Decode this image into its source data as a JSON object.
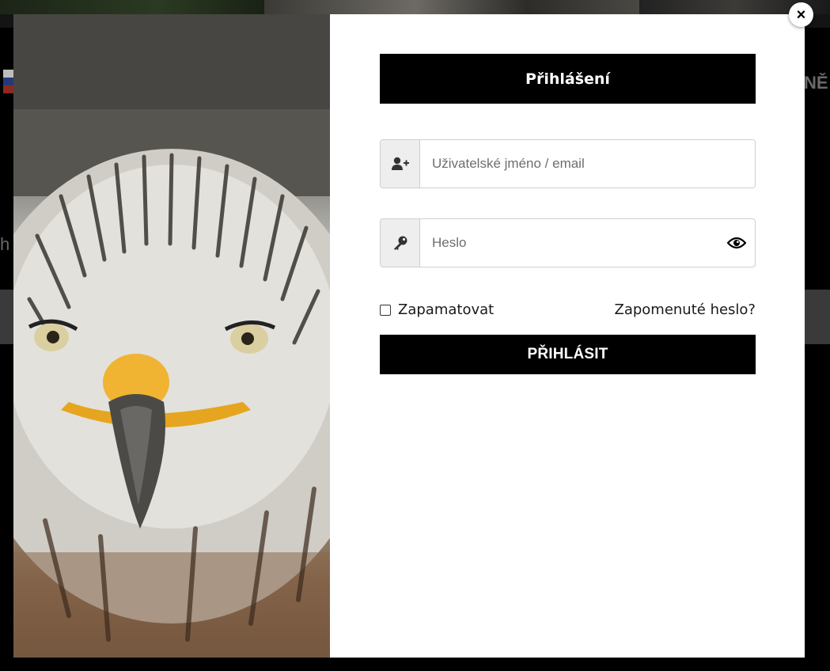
{
  "background": {
    "nav_fragment": "NĚ",
    "side_fragment": "h",
    "flag_colors": [
      "#ffffff",
      "#1c3f95",
      "#d52b1e"
    ]
  },
  "modal": {
    "close_symbol": "×",
    "image_alt": "eagle-portrait",
    "title": "Přihlášení",
    "username": {
      "placeholder": "Uživatelské jméno / email",
      "icon": "user-plus-icon"
    },
    "password": {
      "placeholder": "Heslo",
      "icon": "key-icon",
      "toggle_icon": "eye-icon"
    },
    "remember_label": "Zapamatovat",
    "forgot_label": "Zapomenuté heslo?",
    "submit_label": "PŘIHLÁSIT"
  },
  "colors": {
    "button_bg": "#000000",
    "button_text": "#ffffff",
    "addon_bg": "#eeeeee",
    "border": "#cfcfcf"
  }
}
